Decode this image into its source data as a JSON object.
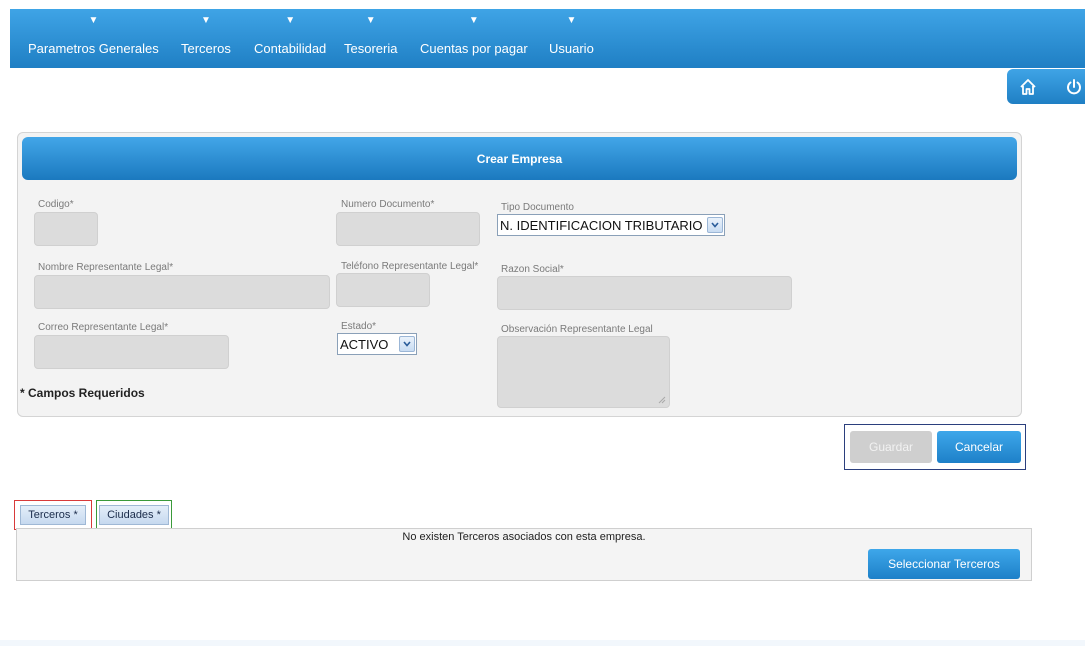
{
  "nav": {
    "items": [
      {
        "label": "Parametros Generales",
        "arrow": "▼"
      },
      {
        "label": "Terceros",
        "arrow": "▼"
      },
      {
        "label": "Contabilidad",
        "arrow": "▼"
      },
      {
        "label": "Tesoreria",
        "arrow": "▼"
      },
      {
        "label": "Cuentas por pagar",
        "arrow": "▼"
      },
      {
        "label": "Usuario",
        "arrow": "▼"
      }
    ]
  },
  "corner": {
    "icons": [
      "home-icon",
      "power-icon"
    ]
  },
  "form": {
    "title": "Crear Empresa",
    "fields": {
      "codigo": {
        "label": "Codigo*",
        "value": ""
      },
      "numero_documento": {
        "label": "Numero Documento*",
        "value": ""
      },
      "tipo_documento": {
        "label": "Tipo Documento",
        "value": "N. IDENTIFICACION TRIBUTARIO"
      },
      "nombre_representante": {
        "label": "Nombre Representante Legal*",
        "value": ""
      },
      "telefono_representante": {
        "label": "Teléfono Representante Legal*",
        "value": ""
      },
      "razon_social": {
        "label": "Razon Social*",
        "value": ""
      },
      "correo_representante": {
        "label": "Correo Representante Legal*",
        "value": ""
      },
      "estado": {
        "label": "Estado*",
        "value": "ACTIVO"
      },
      "observacion": {
        "label": "Observación Representante Legal",
        "value": ""
      }
    },
    "required_note": "* Campos Requeridos"
  },
  "actions": {
    "guardar": "Guardar",
    "cancelar": "Cancelar"
  },
  "tabs": {
    "items": [
      {
        "label": "Terceros *"
      },
      {
        "label": "Ciudades *"
      }
    ],
    "empty_message": "No existen Terceros asociados con esta empresa.",
    "select_button": "Seleccionar Terceros"
  },
  "colors": {
    "primary_blue": "#1f7fc4",
    "panel_bg": "#f3f3f3"
  }
}
